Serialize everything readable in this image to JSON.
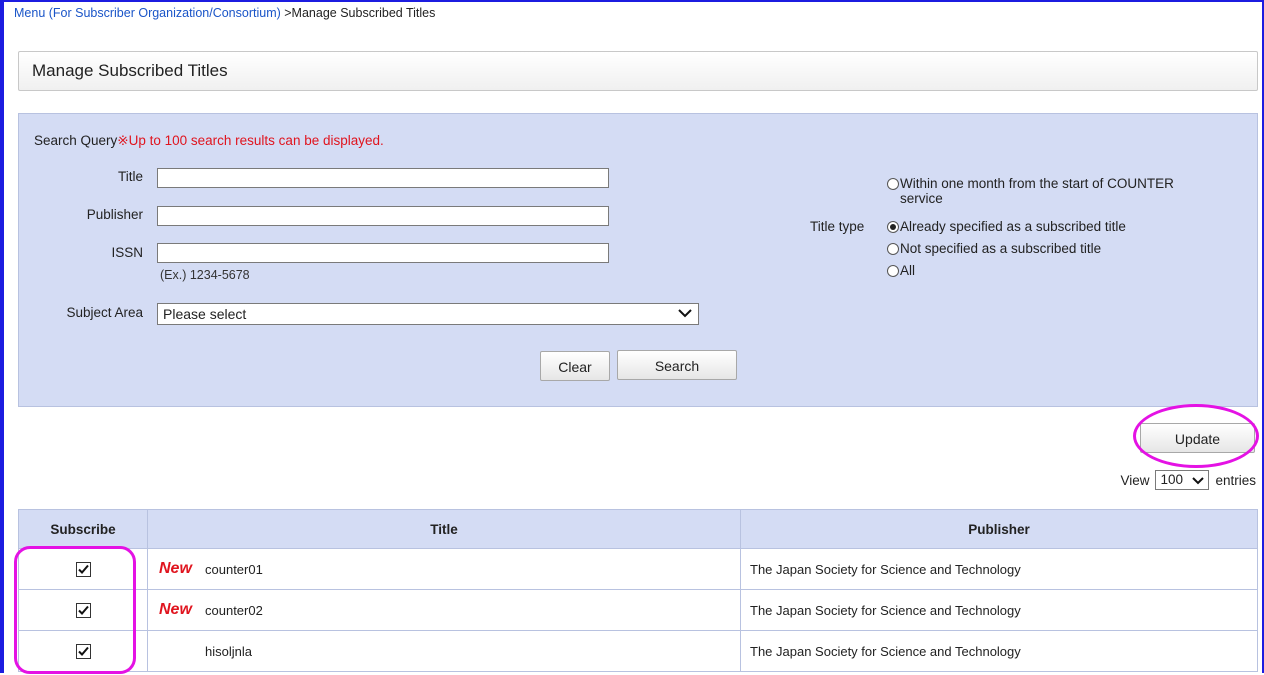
{
  "breadcrumb": {
    "link": "Menu (For Subscriber Organization/Consortium)",
    "current": " >Manage Subscribed Titles"
  },
  "page_title": "Manage Subscribed Titles",
  "search": {
    "query_label": "Search Query",
    "query_note": "※Up to 100 search results can be displayed.",
    "title_label": "Title",
    "title_value": "",
    "publisher_label": "Publisher",
    "publisher_value": "",
    "issn_label": "ISSN",
    "issn_value": "",
    "issn_hint": "(Ex.) 1234-5678",
    "subject_label": "Subject Area",
    "subject_selected": "Please select",
    "clear_label": "Clear",
    "search_label": "Search",
    "title_type_label": "Title type",
    "title_type_options": [
      {
        "label": "Within one month from the start of COUNTER",
        "label2": "service",
        "selected": false
      },
      {
        "label": "Already specified as a subscribed title",
        "selected": true
      },
      {
        "label": "Not specified as a subscribed title",
        "selected": false
      },
      {
        "label": "All",
        "selected": false
      }
    ]
  },
  "update_label": "Update",
  "view": {
    "prefix": "View",
    "selected": "100",
    "suffix": "entries"
  },
  "table": {
    "headers": [
      "Subscribe",
      "Title",
      "Publisher"
    ],
    "rows": [
      {
        "subscribed": true,
        "is_new": true,
        "new_label": "New",
        "title": "counter01",
        "publisher": "The Japan Society for Science and Technology"
      },
      {
        "subscribed": true,
        "is_new": true,
        "new_label": "New",
        "title": "counter02",
        "publisher": "The Japan Society for Science and Technology"
      },
      {
        "subscribed": true,
        "is_new": false,
        "new_label": "",
        "title": "hisoljnla",
        "publisher": "The Japan Society for Science and Technology"
      }
    ]
  },
  "colors": {
    "frame_border": "#1c1ce0",
    "panel_bg": "#d4dcf4",
    "note_red": "#e0141e",
    "highlight_magenta": "#e412e4",
    "link_blue": "#1a55c8"
  }
}
